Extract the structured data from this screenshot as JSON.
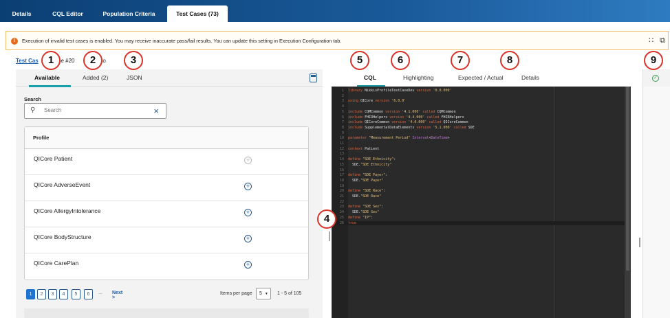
{
  "tabs": [
    {
      "label": "Details"
    },
    {
      "label": "CQL Editor"
    },
    {
      "label": "Population Criteria"
    },
    {
      "label": "Test Cases (73)"
    }
  ],
  "warning": {
    "icon": "!",
    "text": "Execution of invalid test cases is enabled. You may receive inaccurate pass/fail results. You can update this setting in Execution Configuration tab.",
    "tools_icons": [
      "drag-handle-icon",
      "copy-icon"
    ]
  },
  "breadcrumb": {
    "link": "Test Cas",
    "middle": "ase #20",
    "rest": "- Enco"
  },
  "badges": [
    "1",
    "2",
    "3",
    "4",
    "5",
    "6",
    "7",
    "8",
    "9"
  ],
  "left_panel": {
    "tabs": [
      "Available",
      "Added (2)",
      "JSON"
    ],
    "search_label": "Search",
    "search_placeholder": "Search",
    "table_header": "Profile",
    "profiles": [
      {
        "name": "QICore Patient",
        "enabled": false
      },
      {
        "name": "QICore AdverseEvent",
        "enabled": true
      },
      {
        "name": "QICore AllergyIntolerance",
        "enabled": true
      },
      {
        "name": "QICore BodyStructure",
        "enabled": true
      },
      {
        "name": "QICore CarePlan",
        "enabled": true
      }
    ],
    "pagination": {
      "pages": [
        "1",
        "2",
        "3",
        "4",
        "5",
        "6"
      ],
      "current": "1",
      "ellipsis": "...",
      "next": "Next >",
      "items_per_page_label": "Items per page",
      "items_per_page_value": "5",
      "range": "1 - 5 of 105"
    }
  },
  "right_panel": {
    "tabs": [
      "CQL",
      "Highlighting",
      "Expected / Actual",
      "Details"
    ]
  },
  "code_lines": [
    {
      "n": "1",
      "t": "library NikkisProfileTestCaseDev version '0.0.000'"
    },
    {
      "n": "2",
      "t": ""
    },
    {
      "n": "3",
      "t": "using QICore version '6.0.0'"
    },
    {
      "n": "4",
      "t": ""
    },
    {
      "n": "5",
      "t": "include CQMCommon version '4.1.000' called CQMCommon"
    },
    {
      "n": "6",
      "t": "include FHIRHelpers version '4.4.000' called FHIRHelpers"
    },
    {
      "n": "7",
      "t": "include QICoreCommon version '4.0.000' called QICoreCommon"
    },
    {
      "n": "8",
      "t": "include SupplementalDataElements version '5.1.000' called SDE"
    },
    {
      "n": "9",
      "t": ""
    },
    {
      "n": "10",
      "t": "parameter \"Measurement Period\" Interval<DateTime>"
    },
    {
      "n": "11",
      "t": ""
    },
    {
      "n": "12",
      "t": "context Patient"
    },
    {
      "n": "13",
      "t": ""
    },
    {
      "n": "14",
      "t": "define \"SDE Ethnicity\":"
    },
    {
      "n": "15",
      "t": "  SDE.\"SDE Ethnicity\""
    },
    {
      "n": "16",
      "t": ""
    },
    {
      "n": "17",
      "t": "define \"SDE Payer\":"
    },
    {
      "n": "18",
      "t": "  SDE.\"SDE Payer\""
    },
    {
      "n": "19",
      "t": ""
    },
    {
      "n": "20",
      "t": "define \"SDE Race\":"
    },
    {
      "n": "21",
      "t": "  SDE.\"SDE Race\""
    },
    {
      "n": "22",
      "t": ""
    },
    {
      "n": "23",
      "t": "define \"SDE Sex\":"
    },
    {
      "n": "24",
      "t": "  SDE.\"SDE Sex\""
    },
    {
      "n": "25",
      "t": "define \"IP\":"
    },
    {
      "n": "26",
      "t": "true"
    }
  ],
  "colors": {
    "nav_dark": "#0b3f73",
    "accent_teal": "#19a0a8",
    "badge_red": "#d9332b",
    "warning_orange": "#e46b1c",
    "link_blue": "#1f5fae",
    "editor_bg": "#2a2a2a",
    "pass_green": "#2e9b48"
  }
}
